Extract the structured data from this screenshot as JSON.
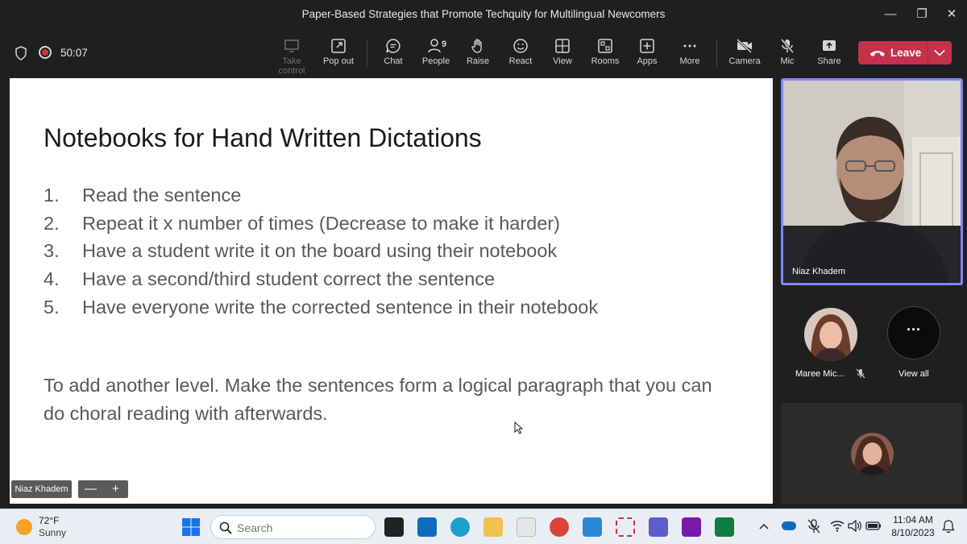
{
  "window": {
    "title": "Paper-Based Strategies that Promote Techquity for Multilingual Newcomers",
    "minimize_glyph": "—",
    "maximize_glyph": "❐",
    "close_glyph": "✕"
  },
  "meeting": {
    "timer": "50:07"
  },
  "toolbar": {
    "take_control": "Take control",
    "pop_out": "Pop out",
    "chat": "Chat",
    "people": "People",
    "people_count": "9",
    "raise": "Raise",
    "react": "React",
    "view": "View",
    "rooms": "Rooms",
    "apps": "Apps",
    "more": "More",
    "camera": "Camera",
    "mic": "Mic",
    "share": "Share",
    "leave": "Leave",
    "leave_color": "#c4314b"
  },
  "slide": {
    "title": "Notebooks for Hand Written Dictations",
    "items": [
      {
        "num": "1.",
        "text": "Read the sentence"
      },
      {
        "num": "2.",
        "text": "Repeat it x number of times (Decrease to make it harder)"
      },
      {
        "num": "3.",
        "text": "Have a student write it on the board using their notebook"
      },
      {
        "num": "4.",
        "text": "Have a second/third student correct the sentence"
      },
      {
        "num": "5.",
        "text": "Have everyone write the corrected sentence in their notebook"
      }
    ],
    "paragraph": "To add another level. Make the sentences form a logical paragraph that you can do choral reading with afterwards."
  },
  "presenter": {
    "name": "Niaz Khadem",
    "zoom_out": "—",
    "zoom_in": "+"
  },
  "participants": {
    "main_video_name": "Niaz Khadem",
    "second_name": "Maree Mic...",
    "view_all": "View all",
    "view_all_dots": "···",
    "active_border_color": "#7f85f5"
  },
  "taskbar": {
    "temperature": "72°F",
    "condition": "Sunny",
    "search_placeholder": "Search",
    "time": "11:04 AM",
    "date": "8/10/2023"
  }
}
